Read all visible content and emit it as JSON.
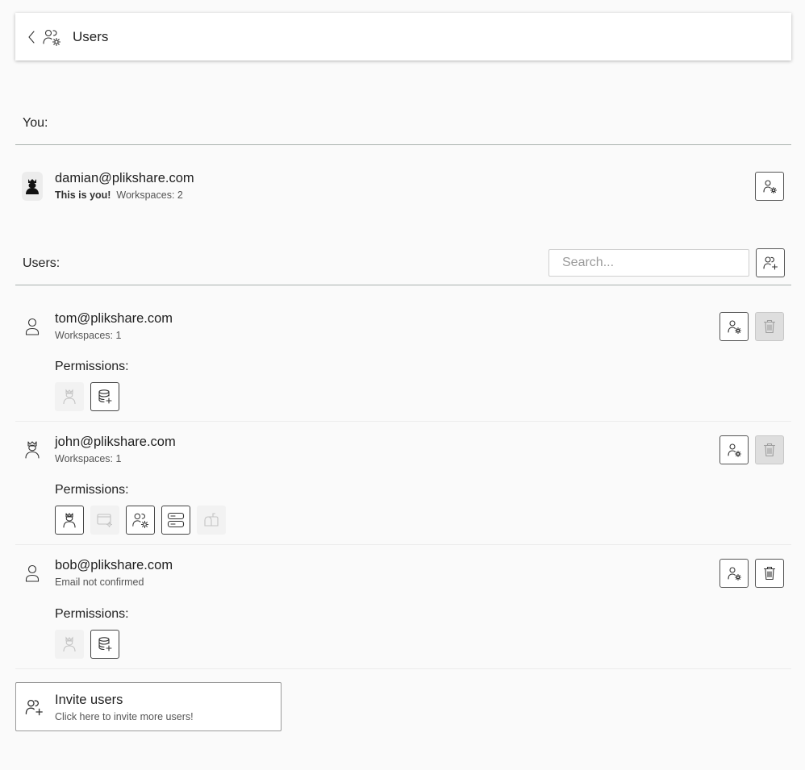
{
  "header": {
    "title": "Users",
    "back_icon": "chevron-left-icon",
    "title_icon": "users-settings-icon"
  },
  "you_section": {
    "label": "You:",
    "user": {
      "email": "damian@plikshare.com",
      "badge": "This is you!",
      "workspaces": "Workspaces: 2",
      "avatar_icon": "admin-avatar-icon"
    }
  },
  "users_section": {
    "label": "Users:",
    "search": {
      "placeholder": "Search...",
      "value": ""
    },
    "users": [
      {
        "email": "tom@plikshare.com",
        "meta": "Workspaces: 1",
        "permissions_label": "Permissions:",
        "permissions": [
          {
            "icon": "admin-icon",
            "active": false
          },
          {
            "icon": "database-add-icon",
            "active": true
          }
        ],
        "delete_disabled": true
      },
      {
        "email": "john@plikshare.com",
        "meta": "Workspaces: 1",
        "permissions_label": "Permissions:",
        "permissions": [
          {
            "icon": "admin-icon",
            "active": true
          },
          {
            "icon": "app-settings-icon",
            "active": false
          },
          {
            "icon": "users-settings-icon",
            "active": true
          },
          {
            "icon": "storage-server-icon",
            "active": true
          },
          {
            "icon": "mailbox-icon",
            "active": false
          }
        ],
        "delete_disabled": true
      },
      {
        "email": "bob@plikshare.com",
        "meta": "Email not confirmed",
        "permissions_label": "Permissions:",
        "permissions": [
          {
            "icon": "admin-icon",
            "active": false
          },
          {
            "icon": "database-add-icon",
            "active": true
          }
        ],
        "delete_disabled": false
      }
    ]
  },
  "invite": {
    "title": "Invite users",
    "subtitle": "Click here to invite more users!"
  }
}
